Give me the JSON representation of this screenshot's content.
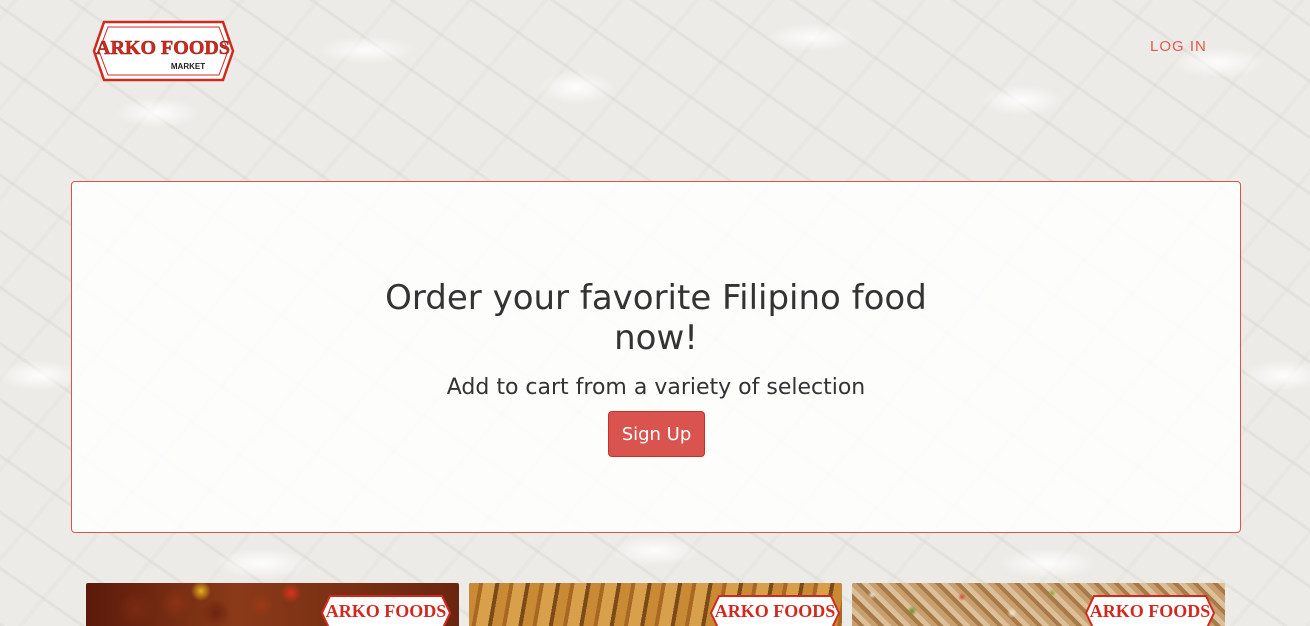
{
  "header": {
    "logo": {
      "brand": "ARKO FOODS",
      "sub": "MARKET"
    },
    "login_label": "LOG IN"
  },
  "hero": {
    "title": "Order your favorite Filipino food now!",
    "subtitle": "Add to cart from a variety of selection",
    "signup_label": "Sign Up"
  },
  "products": [
    {
      "brand": "ARKO FOODS"
    },
    {
      "brand": "ARKO FOODS"
    },
    {
      "brand": "ARKO FOODS"
    }
  ],
  "colors": {
    "accent": "#d9534f",
    "link": "#e05a4e",
    "text": "#333333"
  }
}
